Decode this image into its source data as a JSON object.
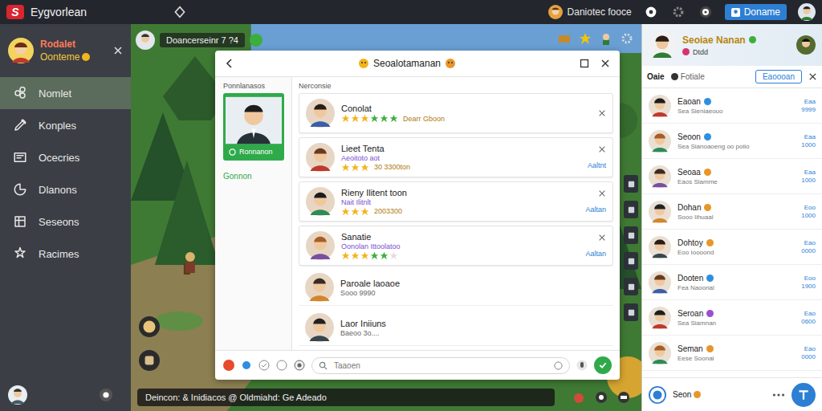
{
  "app": {
    "logo": "S",
    "title": "Eygvorlean"
  },
  "topbar": {
    "user": "Daniotec fooce",
    "button": "Doname"
  },
  "sidebar": {
    "profile": {
      "name": "Rodalet",
      "subtitle": "Oonteme"
    },
    "items": [
      {
        "label": "Nomlet",
        "selected": true
      },
      {
        "label": "Konples",
        "selected": false
      },
      {
        "label": "Ocecries",
        "selected": false
      },
      {
        "label": "Dlanons",
        "selected": false
      },
      {
        "label": "Seseons",
        "selected": false
      },
      {
        "label": "Racimes",
        "selected": false
      }
    ]
  },
  "hud": {
    "player": "Doancerseinr 7 ?4"
  },
  "chat": {
    "text": "Deincon: & Inidiacos @ Oldmiahd: Ge Adeado"
  },
  "dialog": {
    "title": "Seoalotamanan",
    "left_header": "Ponnlanasos",
    "right_header": "Nerconsie",
    "profile_label": "Ronnanon",
    "profile_caption": "Gonnon",
    "search_placeholder": "Taaoen",
    "items": [
      {
        "kind": "rated",
        "name": "Conolat",
        "tag": "",
        "stars": 6,
        "max": 6,
        "note": "Dearr Gboon",
        "action": "",
        "closable": true
      },
      {
        "kind": "rated",
        "name": "Lieet Tenta",
        "tag": "Aeoitoto aot",
        "stars": 3,
        "max": 3,
        "note": "30 3300ton",
        "action": "Aaltnt",
        "closable": true
      },
      {
        "kind": "rated",
        "name": "Rieny Ilitent toon",
        "tag": "Nait Ilitnlt",
        "stars": 3,
        "max": 3,
        "note": "2003300",
        "action": "Aaltan",
        "closable": true
      },
      {
        "kind": "rated",
        "name": "Sanatie",
        "tag": "Oonolan Ittoolatoo",
        "stars": 5,
        "max": 6,
        "note": "",
        "action": "Aaltan",
        "closable": true
      },
      {
        "kind": "plain",
        "name": "Paroale laoaoe",
        "tag": "",
        "stars": 0,
        "max": 0,
        "note": "Sooo 9990",
        "action": "",
        "closable": false
      },
      {
        "kind": "plain",
        "name": "Laor Iniiuns",
        "tag": "",
        "stars": 0,
        "max": 0,
        "note": "Baeoo 3o....",
        "action": "",
        "closable": false
      }
    ]
  },
  "friends": {
    "name": "Seoiae Nanan",
    "subtitle": "Dtdd",
    "tabs": [
      {
        "label": "Oaie",
        "selected": true
      },
      {
        "label": "Fotiale",
        "selected": false
      }
    ],
    "button": "Eaoooan",
    "items": [
      {
        "name": "Eaoan",
        "detail": "Sea Sieniaeouo",
        "rank": "Eaa",
        "score": "9999",
        "color": "#2f8ee0"
      },
      {
        "name": "Seoon",
        "detail": "Sea Sianoaoeng oo poiio",
        "rank": "Eaa",
        "score": "1000",
        "color": "#2f8ee0"
      },
      {
        "name": "Seoaa",
        "detail": "Eaos Siamme",
        "rank": "Eaa",
        "score": "1000",
        "color": "#e8962a"
      },
      {
        "name": "Dohan",
        "detail": "Sooo Iihuaal",
        "rank": "Eoo",
        "score": "1000",
        "color": "#e8962a"
      },
      {
        "name": "Dohtoy",
        "detail": "Eoo Ioooond",
        "rank": "Eao",
        "score": "0000",
        "color": "#e8962a"
      },
      {
        "name": "Dooten",
        "detail": "Fea Naoonal",
        "rank": "Eoo",
        "score": "1900",
        "color": "#2f8ee0"
      },
      {
        "name": "Seroan",
        "detail": "Sea Siamnan",
        "rank": "Eao",
        "score": "0600",
        "color": "#9b4fd0"
      },
      {
        "name": "Seman",
        "detail": "Eese Soonal",
        "rank": "Eao",
        "score": "0000",
        "color": "#e8962a"
      }
    ],
    "footer": "Seon"
  }
}
